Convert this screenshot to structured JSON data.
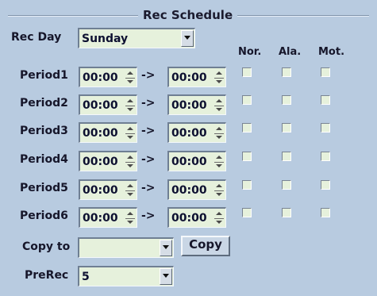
{
  "group": {
    "title": "Rec Schedule"
  },
  "rec_day": {
    "label": "Rec Day",
    "value": "Sunday"
  },
  "columns": {
    "normal": "Nor.",
    "alarm": "Ala.",
    "motion": "Mot."
  },
  "arrow": "->",
  "periods": [
    {
      "label": "Period1",
      "start": "00:00",
      "end": "00:00",
      "normal": false,
      "alarm": false,
      "motion": false
    },
    {
      "label": "Period2",
      "start": "00:00",
      "end": "00:00",
      "normal": false,
      "alarm": false,
      "motion": false
    },
    {
      "label": "Period3",
      "start": "00:00",
      "end": "00:00",
      "normal": false,
      "alarm": false,
      "motion": false
    },
    {
      "label": "Period4",
      "start": "00:00",
      "end": "00:00",
      "normal": false,
      "alarm": false,
      "motion": false
    },
    {
      "label": "Period5",
      "start": "00:00",
      "end": "00:00",
      "normal": false,
      "alarm": false,
      "motion": false
    },
    {
      "label": "Period6",
      "start": "00:00",
      "end": "00:00",
      "normal": false,
      "alarm": false,
      "motion": false
    }
  ],
  "copy_to": {
    "label": "Copy to",
    "value": "",
    "button_label": "Copy"
  },
  "prerec": {
    "label": "PreRec",
    "value": "5"
  },
  "colors": {
    "background": "#b8cbe0",
    "field": "#e6f1dc"
  }
}
